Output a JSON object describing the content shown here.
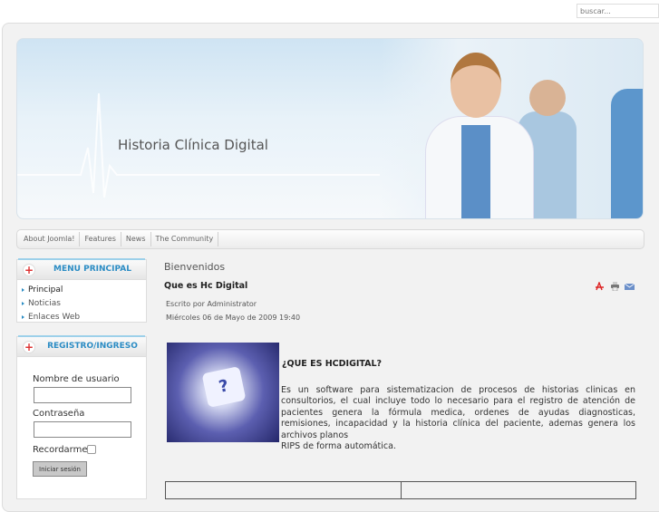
{
  "search": {
    "placeholder": "buscar..."
  },
  "header": {
    "site_title": "Historia Clínica Digital"
  },
  "nav": [
    "About Joomla!",
    "Features",
    "News",
    "The Community"
  ],
  "menu_principal": {
    "title": "MENU PRINCIPAL",
    "items": [
      "Principal",
      "Noticias",
      "Enlaces Web"
    ]
  },
  "login": {
    "title": "REGISTRO/INGRESO",
    "username_label": "Nombre de usuario",
    "password_label": "Contraseña",
    "remember_label": "Recordarme",
    "submit": "Iniciar sesión"
  },
  "main": {
    "heading": "Bienvenidos",
    "article_title": "Que es Hc Digital",
    "author": "Escrito por Administrator",
    "date": "Miércoles 06 de Mayo de 2009 19:40",
    "subtitle": "¿QUE ES HCDIGITAL?",
    "body": "Es un software para sistematizacion de procesos de historias clinicas en consultorios, el cual incluye todo lo necesario para el registro de atención de pacientes genera la fórmula medica, ordenes de ayudas diagnosticas, remisiones, incapacidad y la historia clínica del paciente, ademas genera los archivos planos",
    "body2": "RIPS de forma automática."
  }
}
